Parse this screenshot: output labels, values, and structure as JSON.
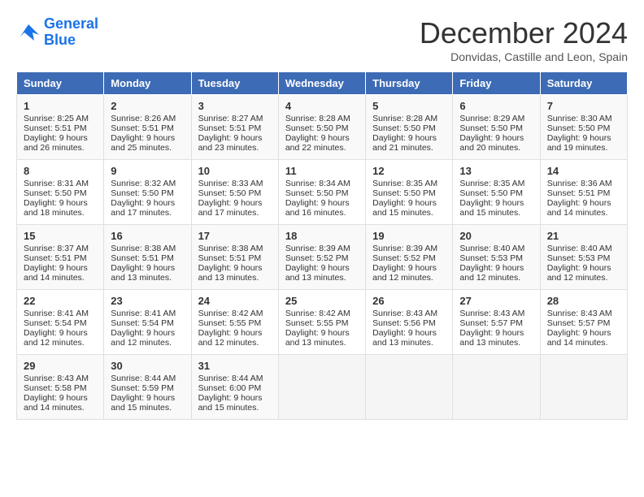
{
  "header": {
    "logo_line1": "General",
    "logo_line2": "Blue",
    "month_title": "December 2024",
    "subtitle": "Donvidas, Castille and Leon, Spain"
  },
  "days_of_week": [
    "Sunday",
    "Monday",
    "Tuesday",
    "Wednesday",
    "Thursday",
    "Friday",
    "Saturday"
  ],
  "weeks": [
    [
      {
        "day": "1",
        "info": "Sunrise: 8:25 AM\nSunset: 5:51 PM\nDaylight: 9 hours and 26 minutes."
      },
      {
        "day": "2",
        "info": "Sunrise: 8:26 AM\nSunset: 5:51 PM\nDaylight: 9 hours and 25 minutes."
      },
      {
        "day": "3",
        "info": "Sunrise: 8:27 AM\nSunset: 5:51 PM\nDaylight: 9 hours and 23 minutes."
      },
      {
        "day": "4",
        "info": "Sunrise: 8:28 AM\nSunset: 5:50 PM\nDaylight: 9 hours and 22 minutes."
      },
      {
        "day": "5",
        "info": "Sunrise: 8:28 AM\nSunset: 5:50 PM\nDaylight: 9 hours and 21 minutes."
      },
      {
        "day": "6",
        "info": "Sunrise: 8:29 AM\nSunset: 5:50 PM\nDaylight: 9 hours and 20 minutes."
      },
      {
        "day": "7",
        "info": "Sunrise: 8:30 AM\nSunset: 5:50 PM\nDaylight: 9 hours and 19 minutes."
      }
    ],
    [
      {
        "day": "8",
        "info": "Sunrise: 8:31 AM\nSunset: 5:50 PM\nDaylight: 9 hours and 18 minutes."
      },
      {
        "day": "9",
        "info": "Sunrise: 8:32 AM\nSunset: 5:50 PM\nDaylight: 9 hours and 17 minutes."
      },
      {
        "day": "10",
        "info": "Sunrise: 8:33 AM\nSunset: 5:50 PM\nDaylight: 9 hours and 17 minutes."
      },
      {
        "day": "11",
        "info": "Sunrise: 8:34 AM\nSunset: 5:50 PM\nDaylight: 9 hours and 16 minutes."
      },
      {
        "day": "12",
        "info": "Sunrise: 8:35 AM\nSunset: 5:50 PM\nDaylight: 9 hours and 15 minutes."
      },
      {
        "day": "13",
        "info": "Sunrise: 8:35 AM\nSunset: 5:50 PM\nDaylight: 9 hours and 15 minutes."
      },
      {
        "day": "14",
        "info": "Sunrise: 8:36 AM\nSunset: 5:51 PM\nDaylight: 9 hours and 14 minutes."
      }
    ],
    [
      {
        "day": "15",
        "info": "Sunrise: 8:37 AM\nSunset: 5:51 PM\nDaylight: 9 hours and 14 minutes."
      },
      {
        "day": "16",
        "info": "Sunrise: 8:38 AM\nSunset: 5:51 PM\nDaylight: 9 hours and 13 minutes."
      },
      {
        "day": "17",
        "info": "Sunrise: 8:38 AM\nSunset: 5:51 PM\nDaylight: 9 hours and 13 minutes."
      },
      {
        "day": "18",
        "info": "Sunrise: 8:39 AM\nSunset: 5:52 PM\nDaylight: 9 hours and 13 minutes."
      },
      {
        "day": "19",
        "info": "Sunrise: 8:39 AM\nSunset: 5:52 PM\nDaylight: 9 hours and 12 minutes."
      },
      {
        "day": "20",
        "info": "Sunrise: 8:40 AM\nSunset: 5:53 PM\nDaylight: 9 hours and 12 minutes."
      },
      {
        "day": "21",
        "info": "Sunrise: 8:40 AM\nSunset: 5:53 PM\nDaylight: 9 hours and 12 minutes."
      }
    ],
    [
      {
        "day": "22",
        "info": "Sunrise: 8:41 AM\nSunset: 5:54 PM\nDaylight: 9 hours and 12 minutes."
      },
      {
        "day": "23",
        "info": "Sunrise: 8:41 AM\nSunset: 5:54 PM\nDaylight: 9 hours and 12 minutes."
      },
      {
        "day": "24",
        "info": "Sunrise: 8:42 AM\nSunset: 5:55 PM\nDaylight: 9 hours and 12 minutes."
      },
      {
        "day": "25",
        "info": "Sunrise: 8:42 AM\nSunset: 5:55 PM\nDaylight: 9 hours and 13 minutes."
      },
      {
        "day": "26",
        "info": "Sunrise: 8:43 AM\nSunset: 5:56 PM\nDaylight: 9 hours and 13 minutes."
      },
      {
        "day": "27",
        "info": "Sunrise: 8:43 AM\nSunset: 5:57 PM\nDaylight: 9 hours and 13 minutes."
      },
      {
        "day": "28",
        "info": "Sunrise: 8:43 AM\nSunset: 5:57 PM\nDaylight: 9 hours and 14 minutes."
      }
    ],
    [
      {
        "day": "29",
        "info": "Sunrise: 8:43 AM\nSunset: 5:58 PM\nDaylight: 9 hours and 14 minutes."
      },
      {
        "day": "30",
        "info": "Sunrise: 8:44 AM\nSunset: 5:59 PM\nDaylight: 9 hours and 15 minutes."
      },
      {
        "day": "31",
        "info": "Sunrise: 8:44 AM\nSunset: 6:00 PM\nDaylight: 9 hours and 15 minutes."
      },
      {
        "day": "",
        "info": ""
      },
      {
        "day": "",
        "info": ""
      },
      {
        "day": "",
        "info": ""
      },
      {
        "day": "",
        "info": ""
      }
    ]
  ]
}
